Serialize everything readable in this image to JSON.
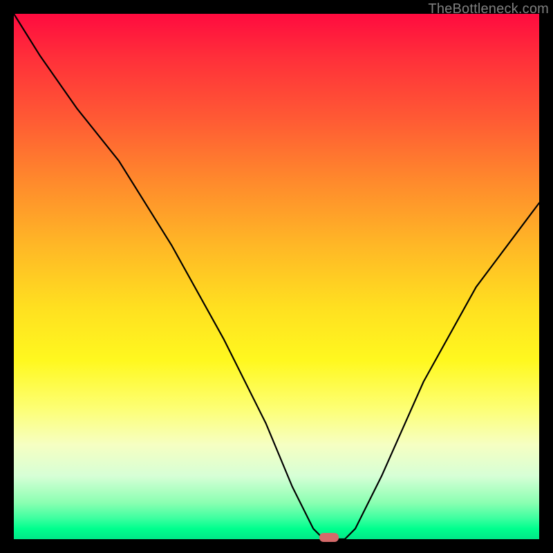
{
  "watermark": "TheBottleneck.com",
  "chart_data": {
    "type": "line",
    "title": "",
    "xlabel": "",
    "ylabel": "",
    "xlim": [
      0,
      100
    ],
    "ylim": [
      0,
      100
    ],
    "grid": false,
    "legend": false,
    "series": [
      {
        "name": "bottleneck-curve",
        "x": [
          0,
          5,
          12,
          20,
          30,
          40,
          48,
          53,
          57,
          59,
          61,
          63,
          65,
          70,
          78,
          88,
          100
        ],
        "y": [
          100,
          92,
          82,
          72,
          56,
          38,
          22,
          10,
          2,
          0,
          0,
          0,
          2,
          12,
          30,
          48,
          64
        ]
      }
    ],
    "marker": {
      "x": 60,
      "y": 0,
      "shape": "pill",
      "color": "#d46a6a"
    },
    "background_gradient": {
      "type": "vertical",
      "stops": [
        {
          "pos": 0.0,
          "color": "#ff0b3f"
        },
        {
          "pos": 0.2,
          "color": "#ff5a34"
        },
        {
          "pos": 0.44,
          "color": "#ffb726"
        },
        {
          "pos": 0.66,
          "color": "#fff81f"
        },
        {
          "pos": 0.82,
          "color": "#f6ffc2"
        },
        {
          "pos": 0.93,
          "color": "#8cffb2"
        },
        {
          "pos": 1.0,
          "color": "#00e788"
        }
      ]
    }
  }
}
